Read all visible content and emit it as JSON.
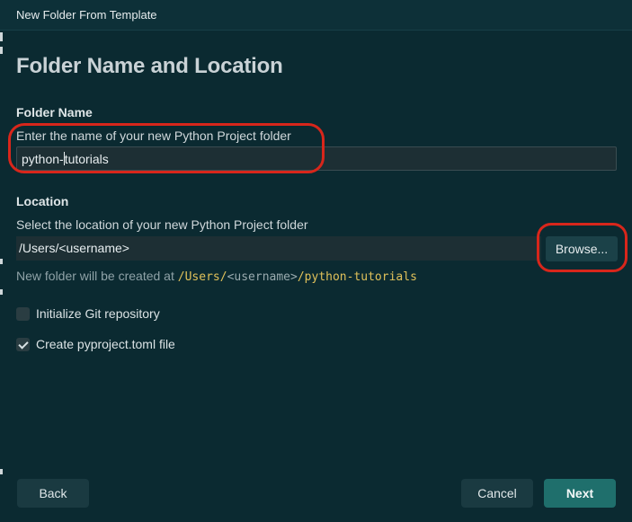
{
  "window": {
    "title": "New Folder From Template"
  },
  "page": {
    "heading": "Folder Name and Location"
  },
  "folder_name": {
    "label": "Folder Name",
    "description": "Enter the name of your new Python Project folder",
    "value_before_caret": "python-",
    "value_after_caret": "tutorials"
  },
  "location": {
    "label": "Location",
    "description": "Select the location of your new Python Project folder",
    "value": "/Users/<username>",
    "browse_label": "Browse..."
  },
  "created_at": {
    "prefix": "New folder will be created at ",
    "path_start": "/Users/",
    "path_placeholder": "<username>",
    "path_end": "/python-tutorials"
  },
  "options": {
    "init_git": {
      "label": "Initialize Git repository",
      "checked": false
    },
    "create_pyproject": {
      "label": "Create pyproject.toml file",
      "checked": true
    }
  },
  "footer": {
    "back_label": "Back",
    "cancel_label": "Cancel",
    "next_label": "Next"
  },
  "colors": {
    "background": "#0b2a31",
    "primary_button": "#1f6f6c",
    "annotation_circle": "#d8261b",
    "path_highlight": "#e0c15a"
  }
}
